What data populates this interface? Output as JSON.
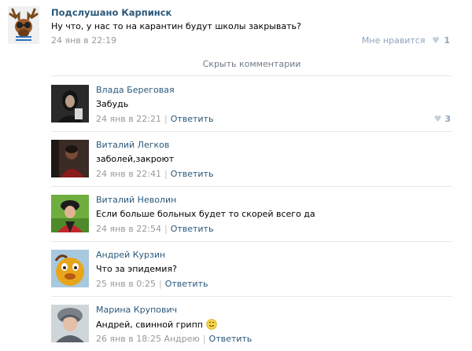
{
  "post": {
    "author": "Подслушано Карпинск",
    "text": "Ну что, у нас то на карантин будут школы закрывать?",
    "date": "24 янв в 22:19",
    "like_label": "Мне нравится",
    "like_count": "1",
    "avatar_icon": "moose-icon"
  },
  "hide_comments_label": "Скрыть комментарии",
  "comments": [
    {
      "author": "Влада Береговая",
      "text": "Забудь",
      "date": "24 янв в 22:21",
      "reply": "Ответить",
      "likes": "3"
    },
    {
      "author": "Виталий Легков",
      "text": "заболей,закроют",
      "date": "24 янв в 22:41",
      "reply": "Ответить"
    },
    {
      "author": "Виталий Неволин",
      "text": "Если больше больных будет то скорей всего да",
      "date": "24 янв в 22:54",
      "reply": "Ответить"
    },
    {
      "author": "Андрей Курзин",
      "text": "Что за эпидемия?",
      "date": "25 янв в 0:25",
      "reply": "Ответить"
    },
    {
      "author": "Марина Крупович",
      "text": "Андрей, свинной грипп",
      "date": "26 янв в 18:25",
      "reply_to": "Андрею",
      "reply": "Ответить",
      "emoji": "smile-emoji-icon"
    }
  ],
  "colors": {
    "link": "#2b587a",
    "muted": "#999999",
    "like": "#8fa3bd",
    "divider": "#e7e8ec"
  }
}
